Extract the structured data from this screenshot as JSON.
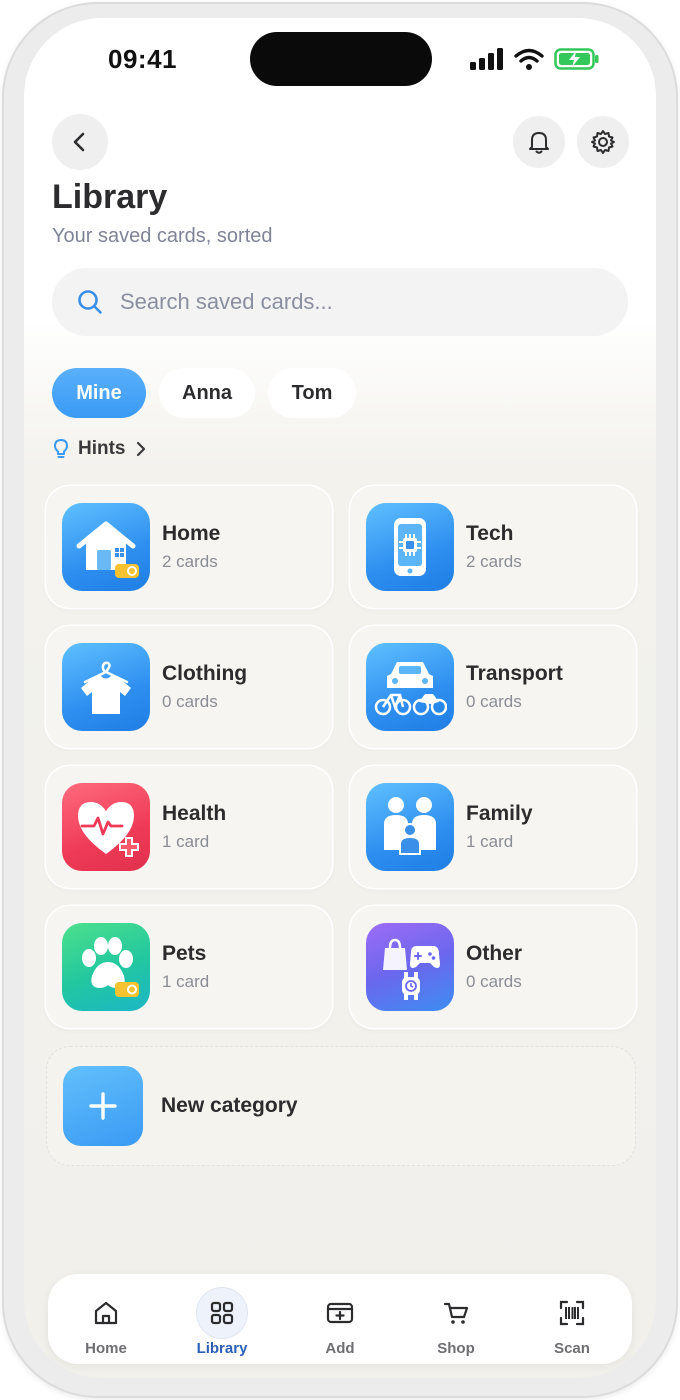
{
  "status_bar": {
    "time": "09:41"
  },
  "header": {
    "title": "Library",
    "subtitle": "Your saved cards, sorted"
  },
  "search": {
    "placeholder": "Search saved cards..."
  },
  "profiles": [
    {
      "label": "Mine",
      "selected": true
    },
    {
      "label": "Anna",
      "selected": false
    },
    {
      "label": "Tom",
      "selected": false
    }
  ],
  "hints": {
    "label": "Hints"
  },
  "categories": [
    {
      "name": "Home",
      "count": "2 cards",
      "icon": "house-icon"
    },
    {
      "name": "Tech",
      "count": "2 cards",
      "icon": "smartphone-chip-icon"
    },
    {
      "name": "Clothing",
      "count": "0 cards",
      "icon": "tshirt-hanger-icon"
    },
    {
      "name": "Transport",
      "count": "0 cards",
      "icon": "car-bike-icon"
    },
    {
      "name": "Health",
      "count": "1 card",
      "icon": "heart-pulse-icon"
    },
    {
      "name": "Family",
      "count": "1 card",
      "icon": "family-icon"
    },
    {
      "name": "Pets",
      "count": "1 card",
      "icon": "paw-icon"
    },
    {
      "name": "Other",
      "count": "0 cards",
      "icon": "bag-gamepad-watch-icon"
    }
  ],
  "new_category": {
    "label": "New category"
  },
  "tabbar": [
    {
      "label": "Home",
      "icon": "home-icon",
      "active": false
    },
    {
      "label": "Library",
      "icon": "grid-icon",
      "active": true
    },
    {
      "label": "Add",
      "icon": "add-card-icon",
      "active": false
    },
    {
      "label": "Shop",
      "icon": "cart-icon",
      "active": false
    },
    {
      "label": "Scan",
      "icon": "barcode-scan-icon",
      "active": false
    }
  ],
  "colors": {
    "accent": "#3a9af4",
    "active_tab": "#2d5fb6",
    "health": "#ef3b57",
    "pets": "#22c7a0",
    "other": "#6b67ee"
  }
}
